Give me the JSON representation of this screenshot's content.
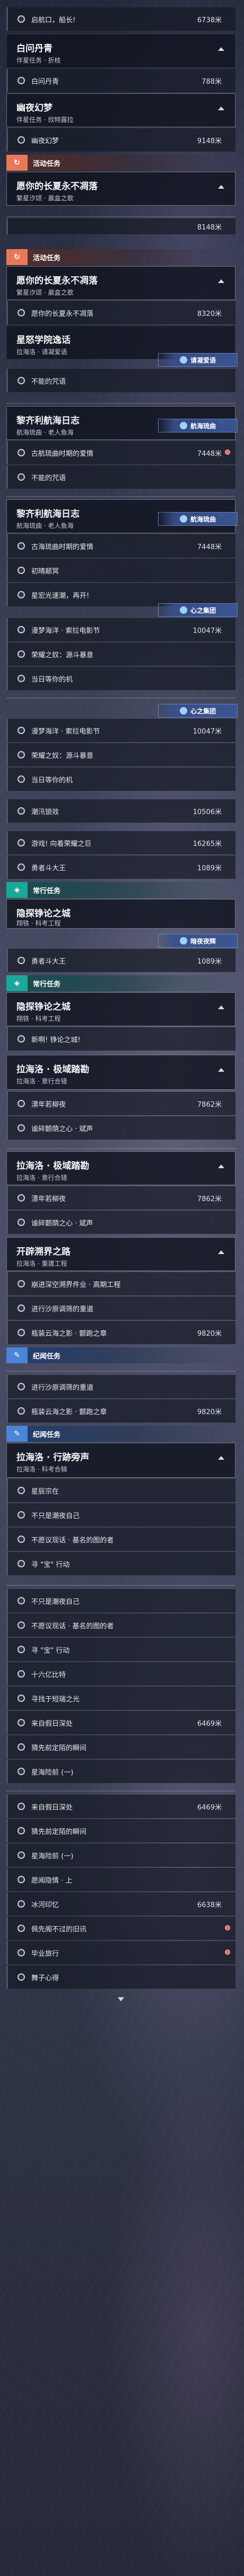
{
  "status_header": "",
  "sections": {
    "s1": {
      "row_top": {
        "label": "启航口，船长!",
        "dist": "6738米"
      },
      "card1": {
        "title": "白问丹青",
        "sub": "伴星任务 · 折枝"
      },
      "card1_row": {
        "label": "白问丹青",
        "dist": "788米"
      },
      "card2": {
        "title": "幽夜幻梦",
        "sub": "伴星任务 · 欣特露拉"
      },
      "card2_row": {
        "label": "幽夜幻梦",
        "dist": "9148米"
      }
    },
    "s2": {
      "header": "活动任务",
      "card": {
        "title": "愿你的长夏永不凋落",
        "sub": "繁星汐颂 · 晨盒之歌"
      }
    },
    "s3": {
      "row_top": {
        "dist": "8148米"
      },
      "header": "活动任务",
      "card": {
        "title": "愿你的长夏永不凋落",
        "sub": "繁星汐颂 · 晨盒之歌"
      },
      "row": {
        "label": "愿你的长夏永不凋落",
        "dist": "8320米"
      },
      "card2": {
        "title": "星怒学院逸话",
        "sub": "拉海洛 · 请凝爱语"
      },
      "tag": "请凝爱语",
      "row2": {
        "label": "不能的咒语"
      }
    },
    "s4": {
      "card": {
        "title": "黎齐利航海日志",
        "sub": "航海琉曲 · 老人鱼海"
      },
      "tag": "航海琉曲",
      "row1": {
        "label": "古航琉曲时期的爱情",
        "dist": "7448米"
      },
      "row2": {
        "label": "不能的咒语"
      }
    },
    "s5": {
      "card": {
        "title": "黎齐利航海日志",
        "sub": "航海琉曲 · 老人鱼海"
      },
      "tag": "航海琉曲",
      "row1": {
        "label": "古海琉曲时期的爱情",
        "dist": "7448米"
      },
      "row2": {
        "label": "初晴颠冥"
      },
      "row3": {
        "label": "星宏光速潮，再开!"
      },
      "tag2": "心之集团",
      "row4": {
        "label": "漫梦海洋 · 索拉电影节",
        "dist": "10047米"
      },
      "row5": {
        "label": "荣耀之奴：源斗暴意"
      },
      "row6": {
        "label": "当日等你的机"
      }
    },
    "s6": {
      "tag": "心之集团",
      "row1": {
        "label": "漫梦海洋 · 索拉电影节",
        "dist": "10047米"
      },
      "row2": {
        "label": "荣耀之奴：源斗暴意"
      },
      "row3": {
        "label": "当日等你的机"
      },
      "row4": {
        "label": "潮汛锁效",
        "dist": "10506米"
      },
      "row5": {
        "label": "游戏! 向着荣耀之巨",
        "dist": "16265米"
      },
      "row6": {
        "label": "勇者斗大王",
        "dist": "1089米"
      },
      "header": "常行任务",
      "card": {
        "title": "隐探铮论之城",
        "sub": "翔铁 · 科考工程"
      },
      "tag2": "暗夜夜辉"
    },
    "s7": {
      "tag": "暗夜夜辉",
      "row1": {
        "label": "勇者斗大王",
        "dist": "1089米"
      },
      "header": "常行任务",
      "card": {
        "title": "隐探铮论之城",
        "sub": "翔铁 · 科考工程"
      },
      "row2": {
        "label": "新啊! 铮论之城!"
      },
      "card2": {
        "title": "拉海洛 · 极域踏勘",
        "sub": "拉海洛 · 意行合错"
      },
      "row3": {
        "label": "漂年若柳夜",
        "dist": "7862米"
      },
      "row4": {
        "label": "谧碎颤荫之心 · 斌声"
      }
    },
    "s8": {
      "card": {
        "title": "拉海洛 · 极域踏勘",
        "sub": "拉海洛 · 意行合错"
      },
      "row1": {
        "label": "漂年若柳夜",
        "dist": "7862米"
      },
      "row2": {
        "label": "谧碎颤荫之心 · 斌声"
      },
      "card2": {
        "title": "开辟溯界之路",
        "sub": "拉海洛 · 重建工程"
      },
      "row3": {
        "label": "崩进深空溯界件业 · 高期工程"
      },
      "row4": {
        "label": "进行沙原调筛的重道"
      },
      "row5": {
        "label": "瓶装云海之影 · 颤跑之章",
        "dist": "9820米"
      },
      "header": "纪闻任务"
    },
    "s9": {
      "row1": {
        "label": "进行沙原调筛的重道"
      },
      "row2": {
        "label": "瓶装云海之影 · 颤跑之章",
        "dist": "9820米"
      },
      "header": "纪闻任务",
      "card": {
        "title": "拉海洛 · 行跡旁声",
        "sub": "拉海洛 · 科考合辑"
      },
      "row3": {
        "label": "星辰宗在"
      },
      "row4": {
        "label": "不只是潮夜自己"
      },
      "row5": {
        "label": "不愿议现话 · 基名的图的者"
      },
      "row6": {
        "label": "寻 \"宝\" 行动"
      }
    },
    "s10": {
      "row1": {
        "label": "不只是潮夜自己"
      },
      "row2": {
        "label": "不愿议现话 · 基名的图的者"
      },
      "row3": {
        "label": "寻 \"宝\" 行动"
      },
      "row4": {
        "label": "十六亿比特"
      },
      "row5": {
        "label": "寻找于短瑞之光"
      },
      "row6": {
        "label": "来自假日深处",
        "dist": "6469米"
      },
      "row7": {
        "label": "猜先前定陌的瞬间"
      },
      "row8": {
        "label": "星海险前 (一)"
      }
    },
    "s11": {
      "row1": {
        "label": "来自假日深处",
        "dist": "6469米"
      },
      "row2": {
        "label": "猜先前定陌的瞬间"
      },
      "row3": {
        "label": "星海险前 (一)"
      },
      "row4": {
        "label": "愿闻隐情 · 上"
      },
      "row5": {
        "label": "冰河印忆",
        "dist": "6638米"
      },
      "row6": {
        "label": "佩先阁不过的旧讯"
      },
      "row7": {
        "label": "毕业旅行"
      },
      "row8": {
        "label": "舞子心得"
      }
    }
  }
}
